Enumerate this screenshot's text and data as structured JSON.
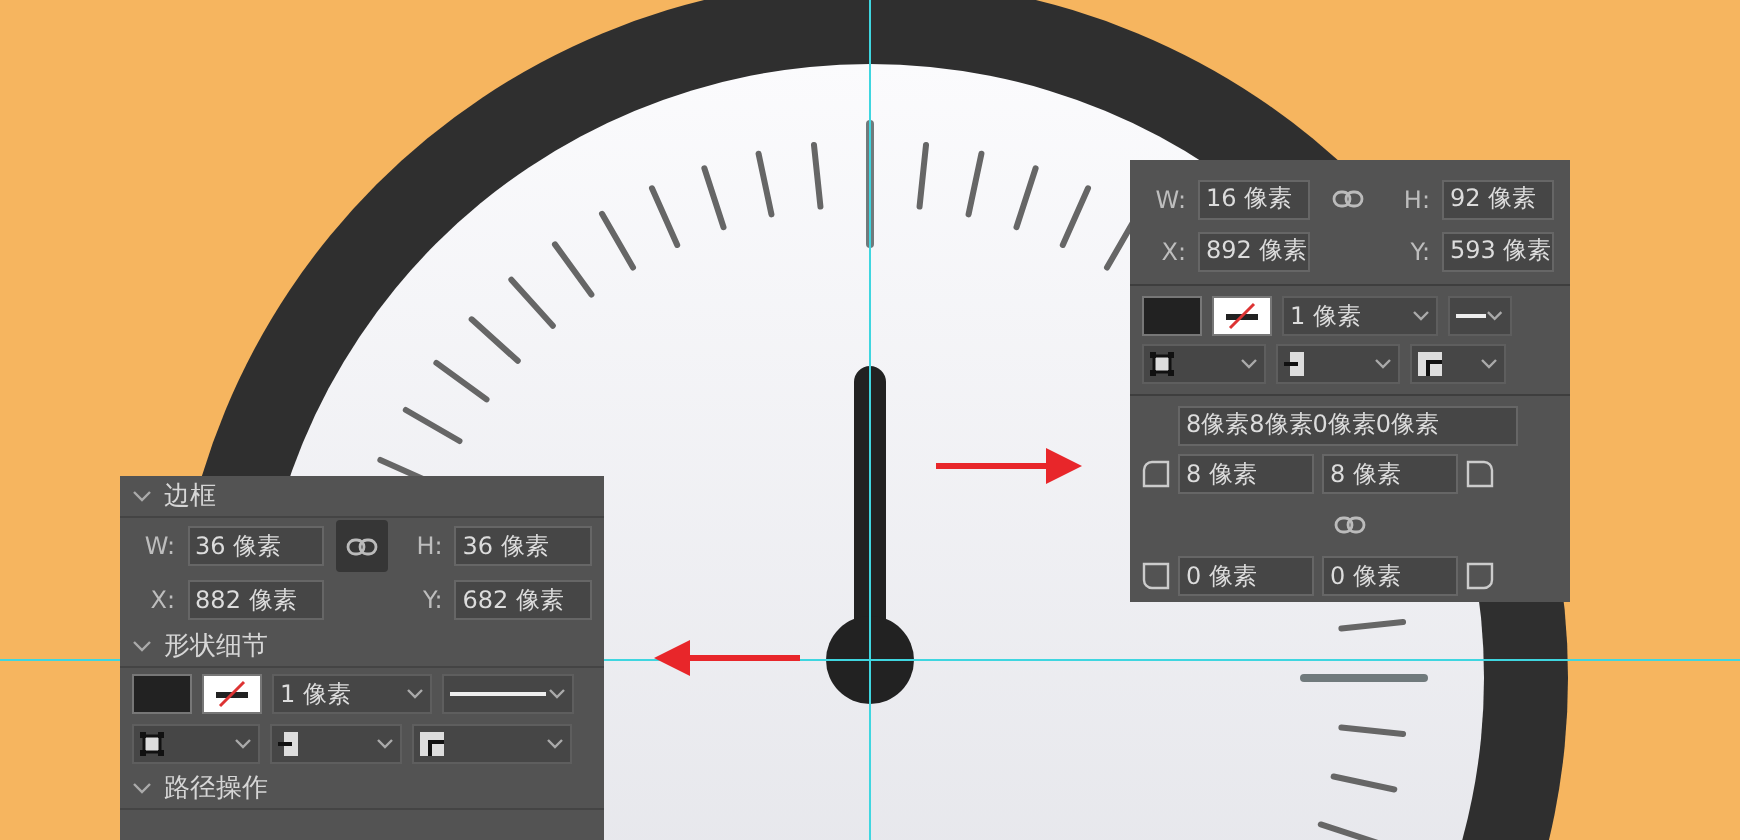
{
  "right_panel": {
    "linked": false,
    "fields": [
      {
        "label": "W:",
        "value": "16 像素"
      },
      {
        "label": "H:",
        "value": "92 像素"
      },
      {
        "label": "X:",
        "value": "892 像素"
      },
      {
        "label": "Y:",
        "value": "593 像素"
      }
    ],
    "stroke_width": "1 像素",
    "corners_all": "8像素8像素0像素0像素",
    "corners": [
      "8 像素",
      "8 像素",
      "0 像素",
      "0 像素"
    ],
    "corners_linked": false
  },
  "left_panel": {
    "linked": true,
    "sections": [
      {
        "title": "边框",
        "expanded": true
      },
      {
        "title": "形状细节",
        "expanded": true
      },
      {
        "title": "路径操作",
        "expanded": true
      }
    ],
    "fields": [
      {
        "label": "W:",
        "value": "36 像素"
      },
      {
        "label": "H:",
        "value": "36 像素"
      },
      {
        "label": "X:",
        "value": "882 像素"
      },
      {
        "label": "Y:",
        "value": "682 像素"
      }
    ],
    "stroke_width": "1 像素"
  }
}
